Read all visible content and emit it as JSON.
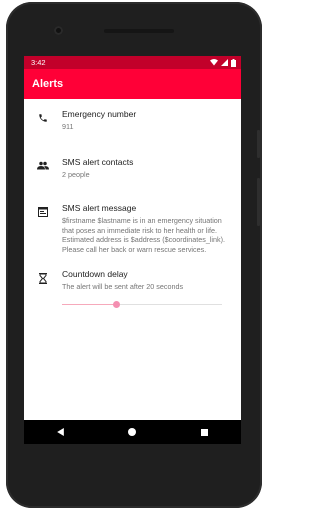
{
  "status_bar": {
    "time": "3:42",
    "icons": [
      "wifi-icon",
      "signal-icon",
      "battery-icon"
    ]
  },
  "app_bar": {
    "title": "Alerts"
  },
  "settings": [
    {
      "icon": "phone-icon",
      "title": "Emergency number",
      "summary": "911"
    },
    {
      "icon": "people-icon",
      "title": "SMS alert contacts",
      "summary": "2 people"
    },
    {
      "icon": "message-icon",
      "title": "SMS alert message",
      "summary": "$firstname $lastname is in an emergency situation that poses an immediate risk to her health or life. Estimated address is $address ($coordinates_link). Please call her back or warn rescue services."
    },
    {
      "icon": "hourglass-icon",
      "title": "Countdown delay",
      "summary": "The alert will be sent after 20 seconds",
      "slider_value": 0.34
    }
  ],
  "nav_bar": {
    "buttons": [
      "back-icon",
      "home-icon",
      "recents-icon"
    ]
  },
  "colors": {
    "status_bar": "#c2002a",
    "app_bar": "#ff0037",
    "slider_thumb": "#f48fb1",
    "slider_fill": "#f6a9bb"
  }
}
